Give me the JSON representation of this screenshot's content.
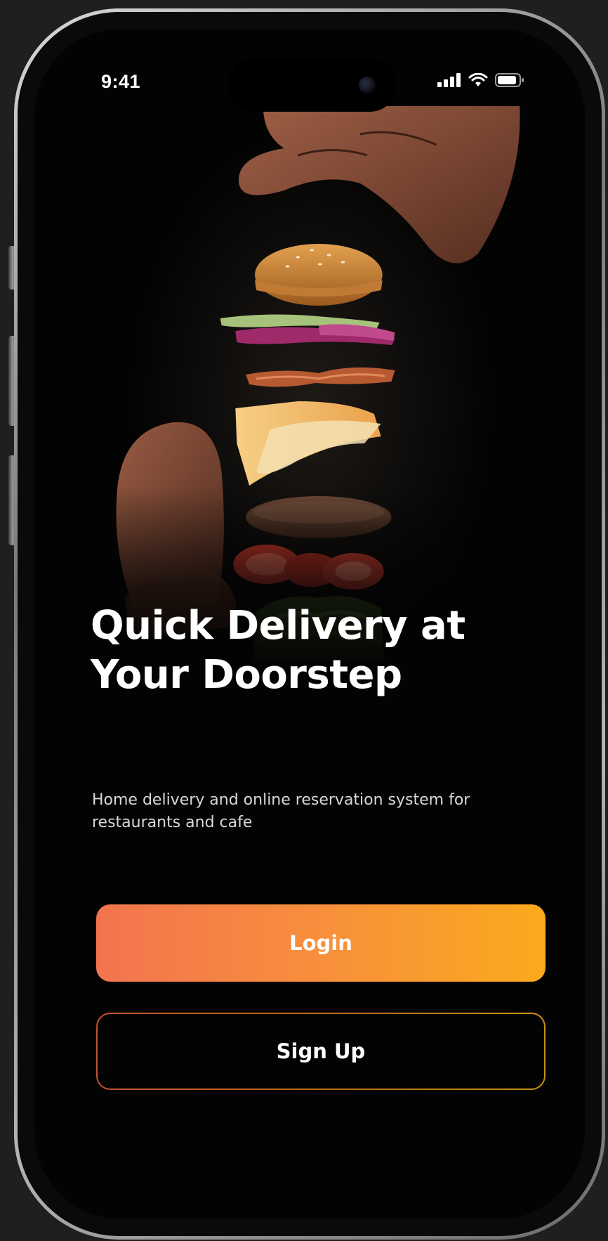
{
  "status_bar": {
    "time": "9:41",
    "icons": [
      "cellular-signal-icon",
      "wifi-icon",
      "battery-icon"
    ]
  },
  "hero": {
    "image_subject": "burger-ingredients-falling-from-hands"
  },
  "onboarding": {
    "title": "Quick Delivery at Your Doorstep",
    "subtitle": "Home delivery and online reservation system for restaurants and cafe"
  },
  "buttons": {
    "login_label": "Login",
    "signup_label": "Sign Up"
  },
  "colors": {
    "background": "#030303",
    "accent_start": "#f2744f",
    "accent_end": "#fbaa1d",
    "text_primary": "#ffffff",
    "text_secondary": "#d8d8d8"
  }
}
